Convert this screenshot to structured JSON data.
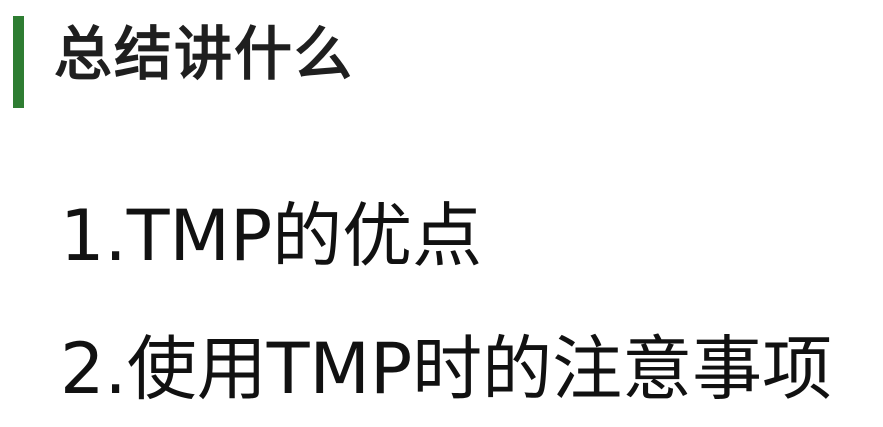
{
  "slide": {
    "title": "总结讲什么",
    "accent_color": "#2e7d32",
    "items": [
      {
        "text": "1.TMP的优点"
      },
      {
        "text": "2.使用TMP时的注意事项"
      }
    ]
  }
}
